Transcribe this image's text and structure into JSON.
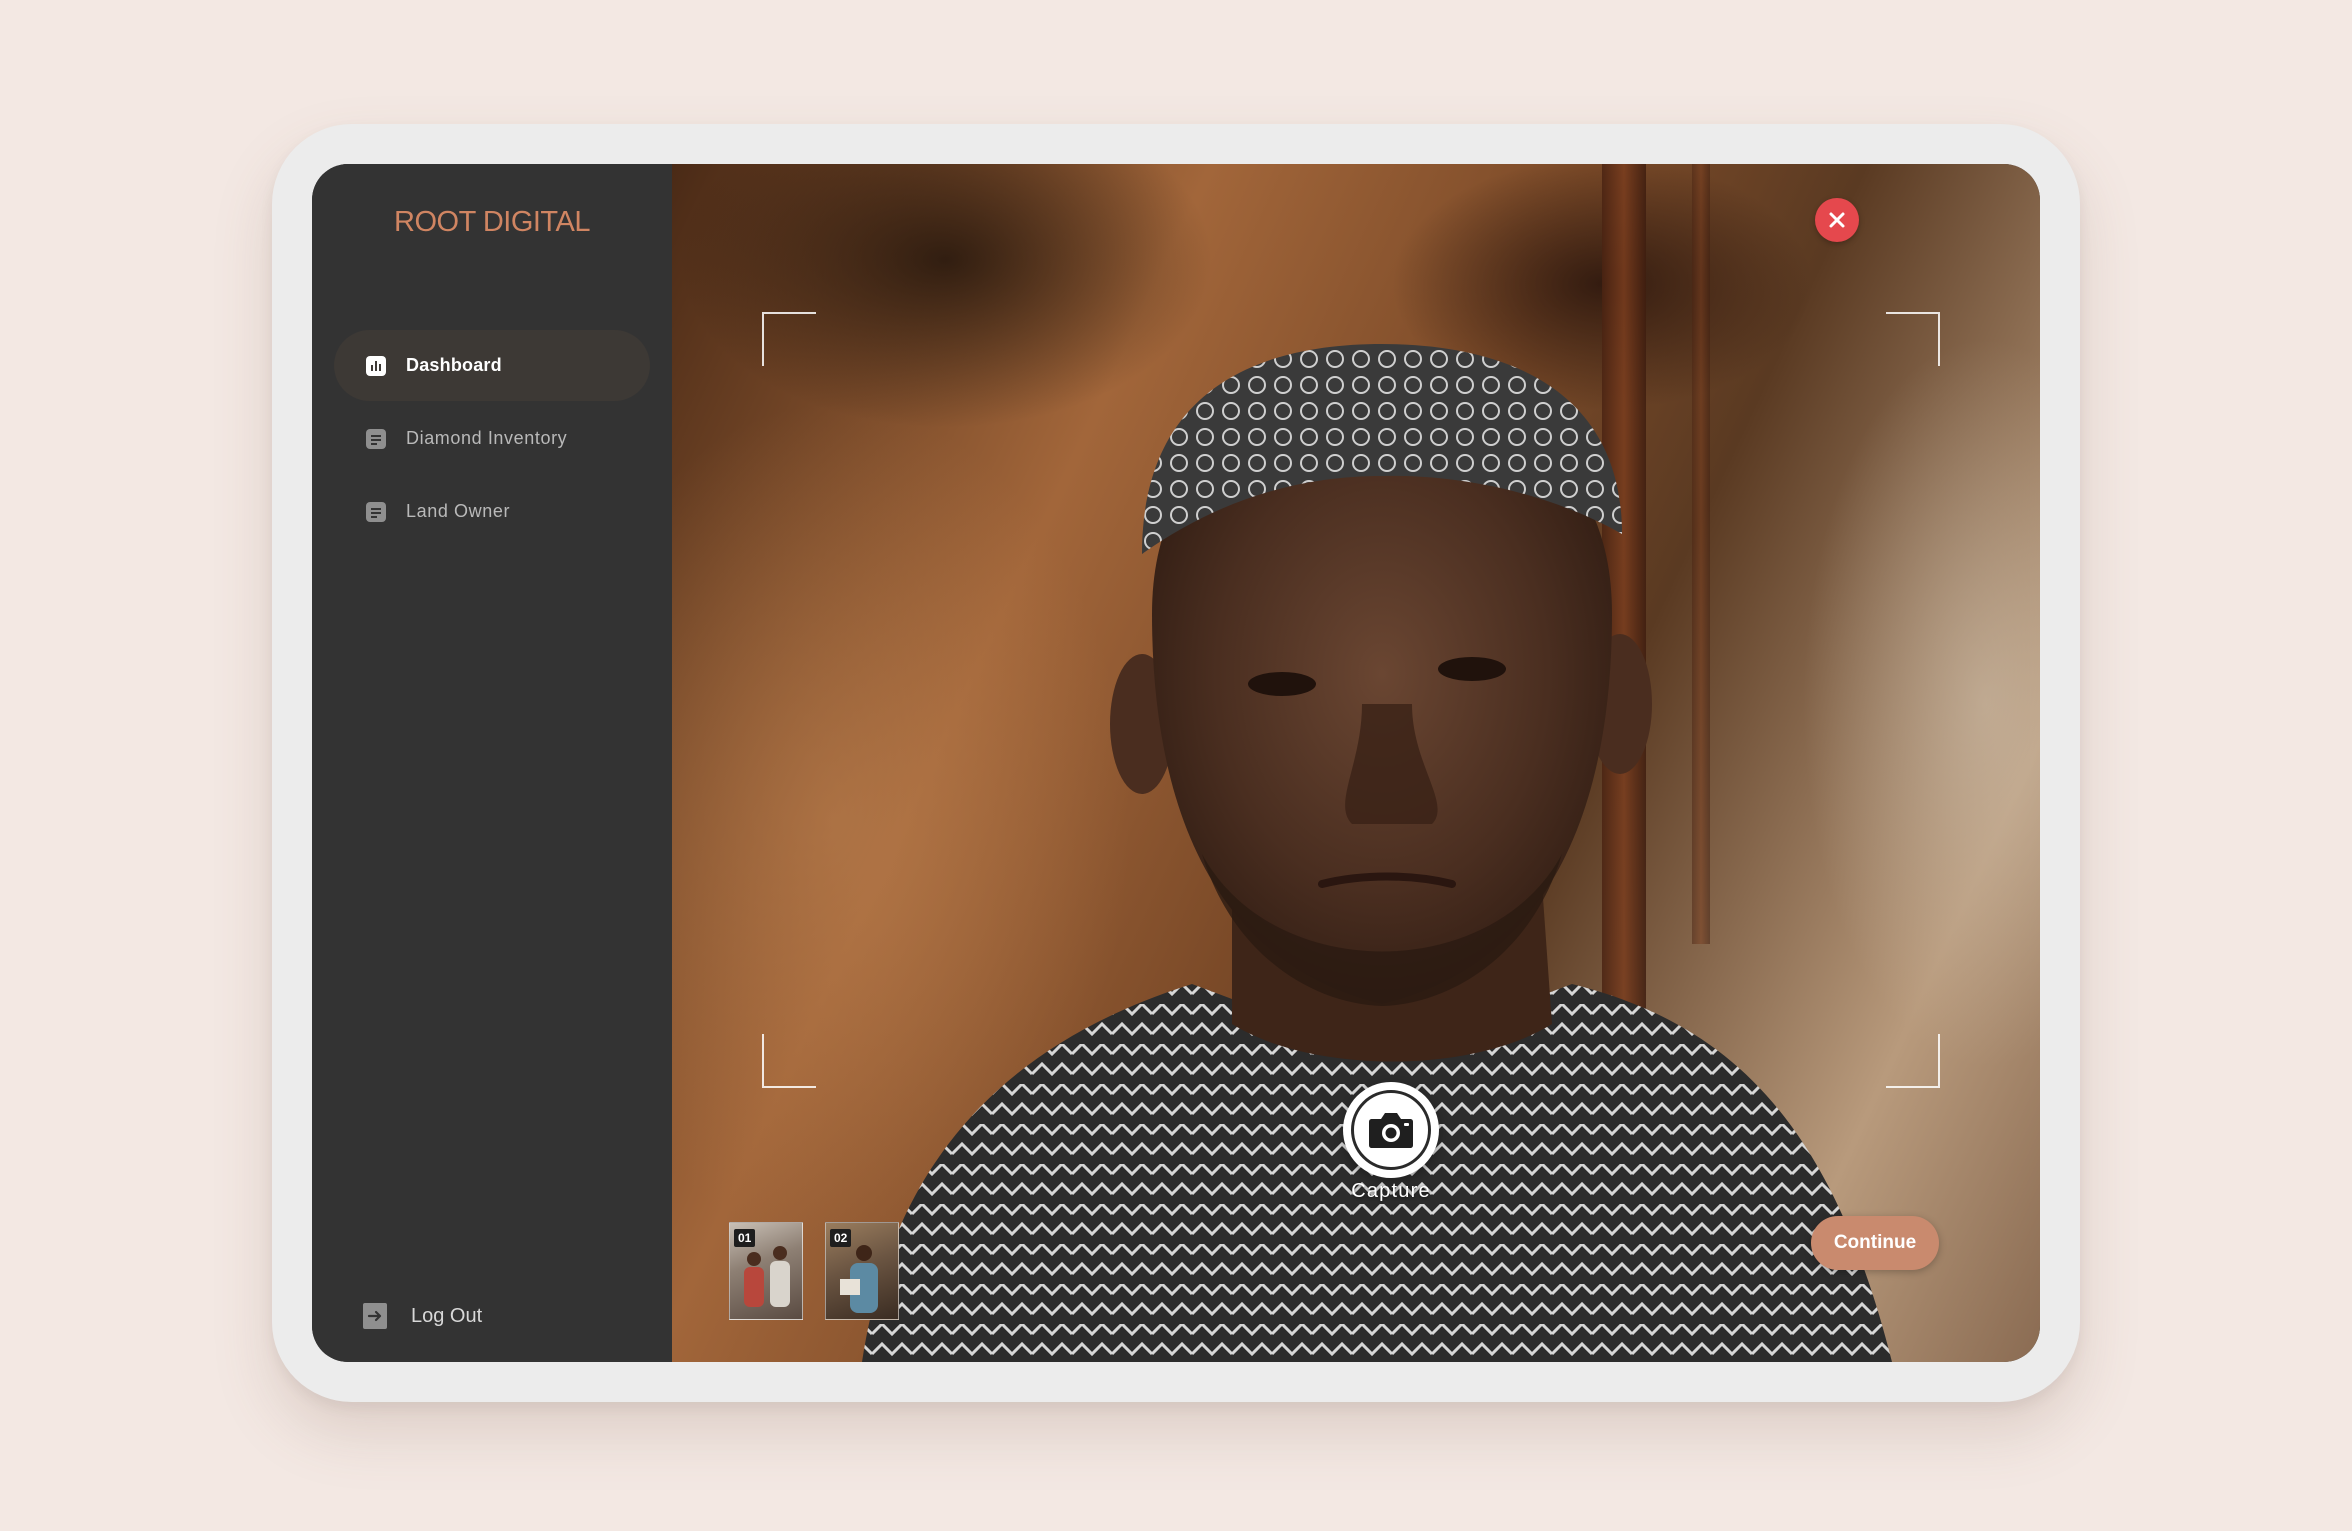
{
  "brand": "ROOT DIGITAL",
  "nav": {
    "items": [
      {
        "label": "Dashboard",
        "icon": "bar-chart-icon",
        "active": true
      },
      {
        "label": "Diamond Inventory",
        "icon": "document-icon",
        "active": false
      },
      {
        "label": "Land Owner",
        "icon": "document-icon",
        "active": false
      }
    ],
    "logout_label": "Log Out"
  },
  "camera": {
    "capture_label": "Capture",
    "continue_label": "Continue",
    "thumbnails": [
      {
        "number": "01"
      },
      {
        "number": "02"
      }
    ]
  },
  "colors": {
    "background": "#f3e8e3",
    "sidebar": "#333333",
    "brand": "#d08562",
    "active_nav": "#3d3935",
    "close": "#e5484d",
    "continue": "#c98a6e"
  }
}
